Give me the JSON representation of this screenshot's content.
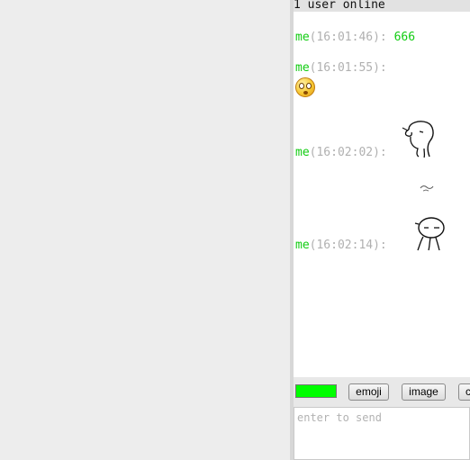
{
  "status": {
    "online_text": "1 user online"
  },
  "messages": [
    {
      "user": "me",
      "time": "(16:01:46):",
      "text": "666"
    },
    {
      "user": "me",
      "time": "(16:01:55):",
      "emoji": "surprised-face-icon"
    },
    {
      "user": "me",
      "time": "(16:02:02):",
      "sticker": "doodle-figure-sticker"
    },
    {
      "user": "me",
      "time": "(16:02:14):",
      "sticker": "doodle-figure-thinking-sticker"
    }
  ],
  "toolbar": {
    "color": "#00ff00",
    "emoji_label": "emoji",
    "image_label": "image",
    "clear_label": "c"
  },
  "input": {
    "placeholder": "enter to send",
    "value": ""
  }
}
